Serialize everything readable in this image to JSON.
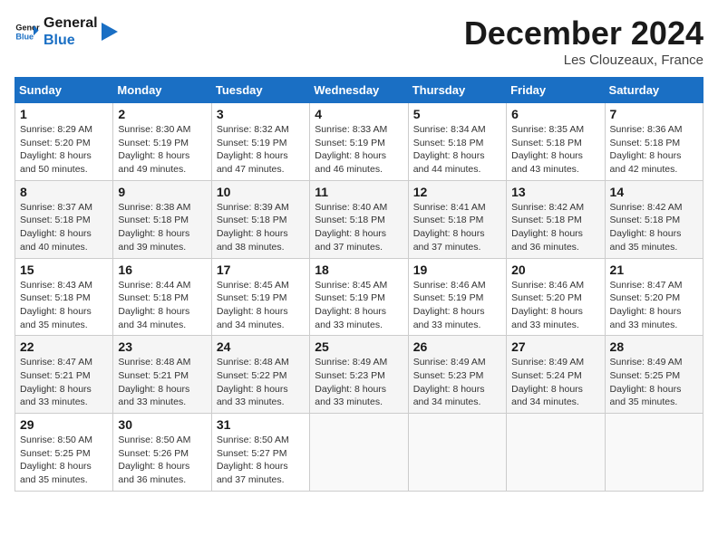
{
  "logo": {
    "text_general": "General",
    "text_blue": "Blue"
  },
  "title": "December 2024",
  "subtitle": "Les Clouzeaux, France",
  "days_header": [
    "Sunday",
    "Monday",
    "Tuesday",
    "Wednesday",
    "Thursday",
    "Friday",
    "Saturday"
  ],
  "weeks": [
    [
      {
        "day": "1",
        "sunrise": "8:29 AM",
        "sunset": "5:20 PM",
        "daylight": "8 hours and 50 minutes."
      },
      {
        "day": "2",
        "sunrise": "8:30 AM",
        "sunset": "5:19 PM",
        "daylight": "8 hours and 49 minutes."
      },
      {
        "day": "3",
        "sunrise": "8:32 AM",
        "sunset": "5:19 PM",
        "daylight": "8 hours and 47 minutes."
      },
      {
        "day": "4",
        "sunrise": "8:33 AM",
        "sunset": "5:19 PM",
        "daylight": "8 hours and 46 minutes."
      },
      {
        "day": "5",
        "sunrise": "8:34 AM",
        "sunset": "5:18 PM",
        "daylight": "8 hours and 44 minutes."
      },
      {
        "day": "6",
        "sunrise": "8:35 AM",
        "sunset": "5:18 PM",
        "daylight": "8 hours and 43 minutes."
      },
      {
        "day": "7",
        "sunrise": "8:36 AM",
        "sunset": "5:18 PM",
        "daylight": "8 hours and 42 minutes."
      }
    ],
    [
      {
        "day": "8",
        "sunrise": "8:37 AM",
        "sunset": "5:18 PM",
        "daylight": "8 hours and 40 minutes."
      },
      {
        "day": "9",
        "sunrise": "8:38 AM",
        "sunset": "5:18 PM",
        "daylight": "8 hours and 39 minutes."
      },
      {
        "day": "10",
        "sunrise": "8:39 AM",
        "sunset": "5:18 PM",
        "daylight": "8 hours and 38 minutes."
      },
      {
        "day": "11",
        "sunrise": "8:40 AM",
        "sunset": "5:18 PM",
        "daylight": "8 hours and 37 minutes."
      },
      {
        "day": "12",
        "sunrise": "8:41 AM",
        "sunset": "5:18 PM",
        "daylight": "8 hours and 37 minutes."
      },
      {
        "day": "13",
        "sunrise": "8:42 AM",
        "sunset": "5:18 PM",
        "daylight": "8 hours and 36 minutes."
      },
      {
        "day": "14",
        "sunrise": "8:42 AM",
        "sunset": "5:18 PM",
        "daylight": "8 hours and 35 minutes."
      }
    ],
    [
      {
        "day": "15",
        "sunrise": "8:43 AM",
        "sunset": "5:18 PM",
        "daylight": "8 hours and 35 minutes."
      },
      {
        "day": "16",
        "sunrise": "8:44 AM",
        "sunset": "5:18 PM",
        "daylight": "8 hours and 34 minutes."
      },
      {
        "day": "17",
        "sunrise": "8:45 AM",
        "sunset": "5:19 PM",
        "daylight": "8 hours and 34 minutes."
      },
      {
        "day": "18",
        "sunrise": "8:45 AM",
        "sunset": "5:19 PM",
        "daylight": "8 hours and 33 minutes."
      },
      {
        "day": "19",
        "sunrise": "8:46 AM",
        "sunset": "5:19 PM",
        "daylight": "8 hours and 33 minutes."
      },
      {
        "day": "20",
        "sunrise": "8:46 AM",
        "sunset": "5:20 PM",
        "daylight": "8 hours and 33 minutes."
      },
      {
        "day": "21",
        "sunrise": "8:47 AM",
        "sunset": "5:20 PM",
        "daylight": "8 hours and 33 minutes."
      }
    ],
    [
      {
        "day": "22",
        "sunrise": "8:47 AM",
        "sunset": "5:21 PM",
        "daylight": "8 hours and 33 minutes."
      },
      {
        "day": "23",
        "sunrise": "8:48 AM",
        "sunset": "5:21 PM",
        "daylight": "8 hours and 33 minutes."
      },
      {
        "day": "24",
        "sunrise": "8:48 AM",
        "sunset": "5:22 PM",
        "daylight": "8 hours and 33 minutes."
      },
      {
        "day": "25",
        "sunrise": "8:49 AM",
        "sunset": "5:23 PM",
        "daylight": "8 hours and 33 minutes."
      },
      {
        "day": "26",
        "sunrise": "8:49 AM",
        "sunset": "5:23 PM",
        "daylight": "8 hours and 34 minutes."
      },
      {
        "day": "27",
        "sunrise": "8:49 AM",
        "sunset": "5:24 PM",
        "daylight": "8 hours and 34 minutes."
      },
      {
        "day": "28",
        "sunrise": "8:49 AM",
        "sunset": "5:25 PM",
        "daylight": "8 hours and 35 minutes."
      }
    ],
    [
      {
        "day": "29",
        "sunrise": "8:50 AM",
        "sunset": "5:25 PM",
        "daylight": "8 hours and 35 minutes."
      },
      {
        "day": "30",
        "sunrise": "8:50 AM",
        "sunset": "5:26 PM",
        "daylight": "8 hours and 36 minutes."
      },
      {
        "day": "31",
        "sunrise": "8:50 AM",
        "sunset": "5:27 PM",
        "daylight": "8 hours and 37 minutes."
      },
      null,
      null,
      null,
      null
    ]
  ]
}
